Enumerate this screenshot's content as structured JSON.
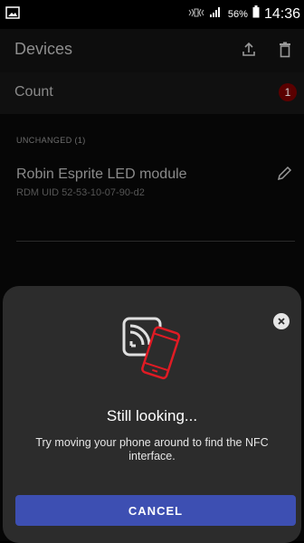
{
  "status_bar": {
    "battery_percent": "56%",
    "time": "14:36",
    "icons": [
      "gallery-icon",
      "nfc-vibrate-icon",
      "signal-icon",
      "battery-icon"
    ]
  },
  "app_bar": {
    "title": "Devices",
    "actions": [
      "upload-icon",
      "delete-icon"
    ]
  },
  "count_row": {
    "label": "Count",
    "value": "1"
  },
  "devices_section": {
    "header": "UNCHANGED (1)",
    "items": [
      {
        "name": "Robin Esprite LED module",
        "uid": "RDM UID 52-53-10-07-90-d2"
      }
    ]
  },
  "nfc_sheet": {
    "title": "Still looking...",
    "message": "Try moving your phone around to find the NFC interface.",
    "cancel_label": "CANCEL"
  },
  "colors": {
    "accent": "#3d4fb2",
    "phone_red": "#e01b24",
    "badge": "#5a0000",
    "sheet_bg": "#2c2c2c"
  }
}
